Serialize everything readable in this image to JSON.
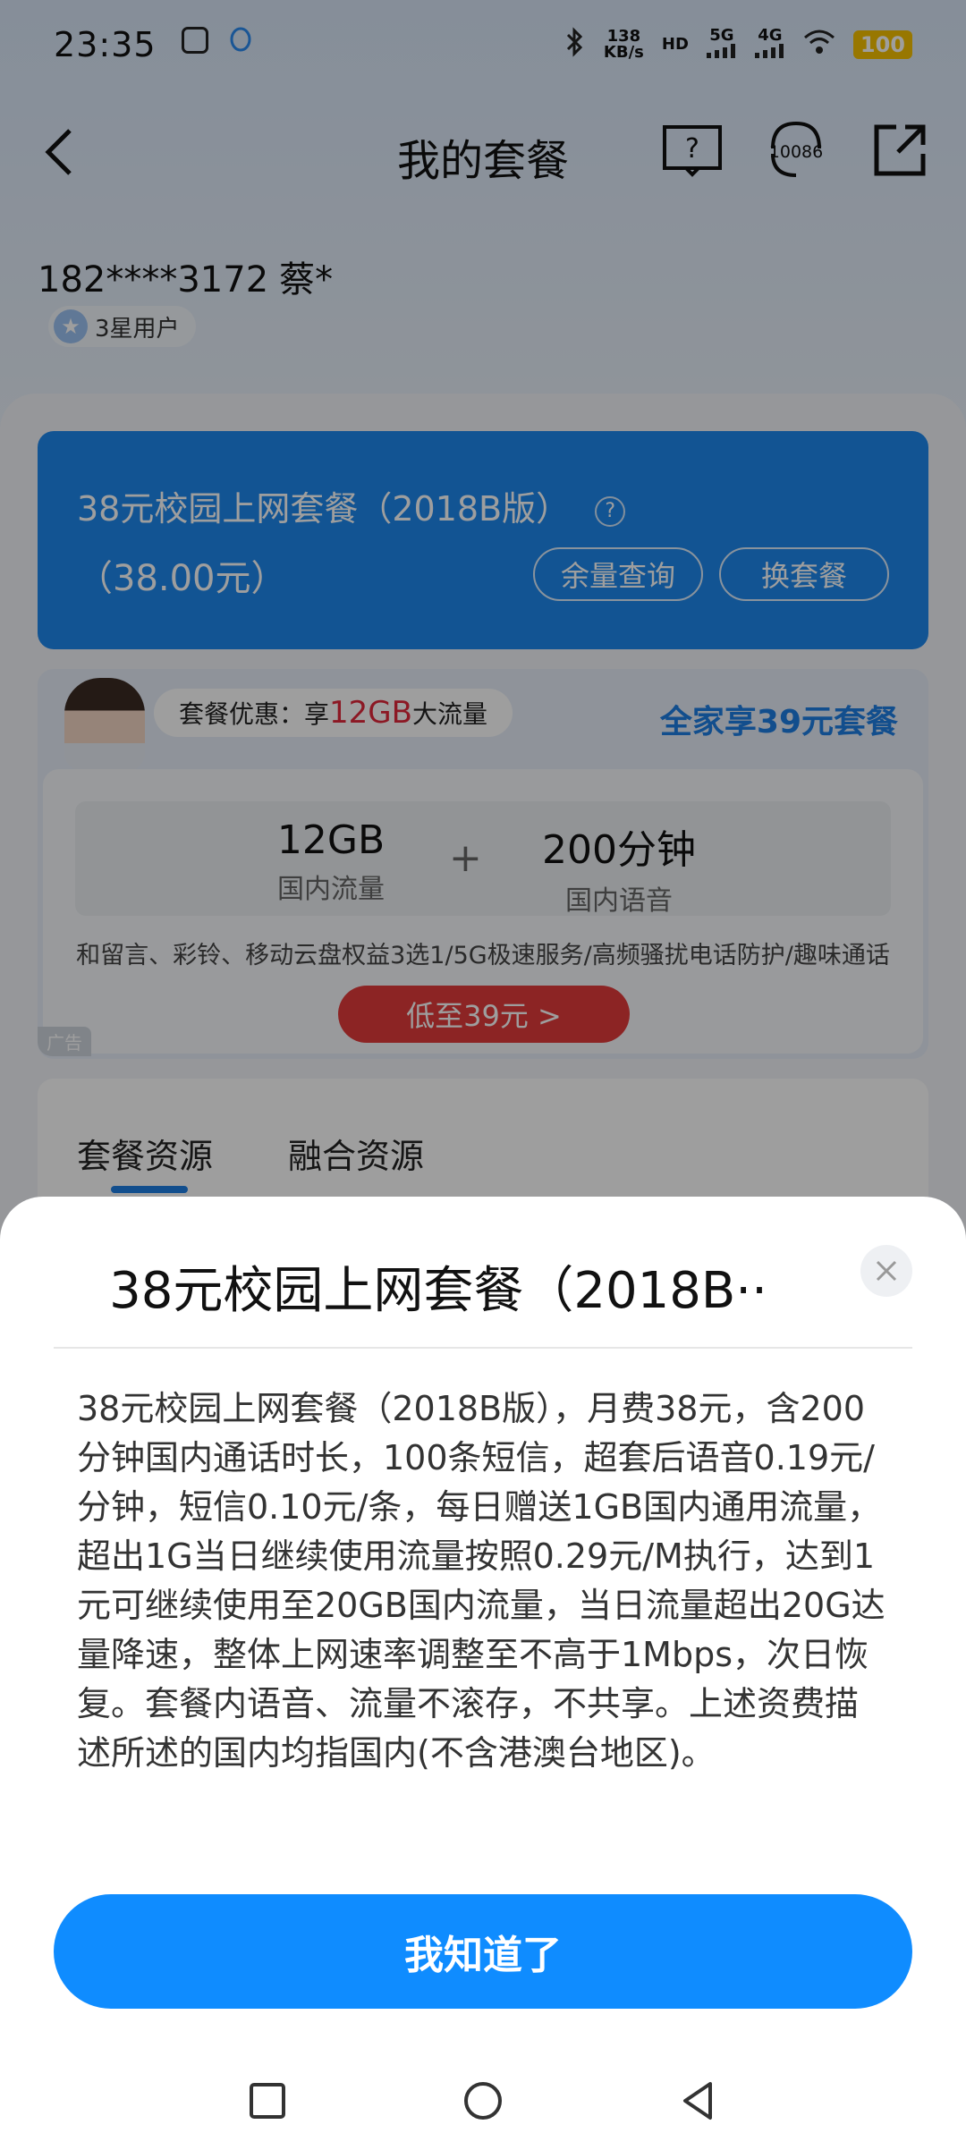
{
  "status_bar": {
    "time": "23:35",
    "net_speed_value": "138",
    "net_speed_unit": "KB/s",
    "hd_label": "HD",
    "net1": "5G",
    "net2": "4G",
    "battery": "100"
  },
  "navbar": {
    "title": "我的套餐",
    "service_number": "10086"
  },
  "user": {
    "phone": "182****3172",
    "name": "蔡*",
    "level": "3星用户"
  },
  "plan_card": {
    "title": "38元校园上网套餐（2018B版）",
    "help": "?",
    "price": "（38.00元）",
    "balance_button": "余量查询",
    "change_button": "换套餐"
  },
  "promo": {
    "bubble_prefix": "套餐优惠：享",
    "bubble_highlight": "12GB",
    "bubble_suffix": "大流量",
    "family_link": "全家享39元套餐",
    "data_value": "12GB",
    "data_label": "国内流量",
    "plus": "+",
    "voice_value": "200分钟",
    "voice_label": "国内语音",
    "benefits": "和留言、彩铃、移动云盘权益3选1/5G极速服务/高频骚扰电话防护/趣味通话",
    "cta": "低至39元 >",
    "ad_tag": "广告"
  },
  "tabs": {
    "tab1": "套餐资源",
    "tab2": "融合资源"
  },
  "sheet": {
    "title": "38元校园上网套餐（2018B··",
    "body": "38元校园上网套餐（2018B版），月费38元，含200分钟国内通话时长，100条短信，超套后语音0.19元/分钟，短信0.10元/条，每日赠送1GB国内通用流量，超出1G当日继续使用流量按照0.29元/M执行，达到1元可继续使用至20GB国内流量，当日流量超出20G达量降速，整体上网速率调整至不高于1Mbps，次日恢复。套餐内语音、流量不滚存，不共享。上述资费描述所述的国内均指国内(不含港澳台地区)。",
    "ok_button": "我知道了"
  },
  "colors": {
    "accent": "#0f8cff",
    "plan_card": "#1e88ee",
    "promo_red": "#e23a3a"
  }
}
